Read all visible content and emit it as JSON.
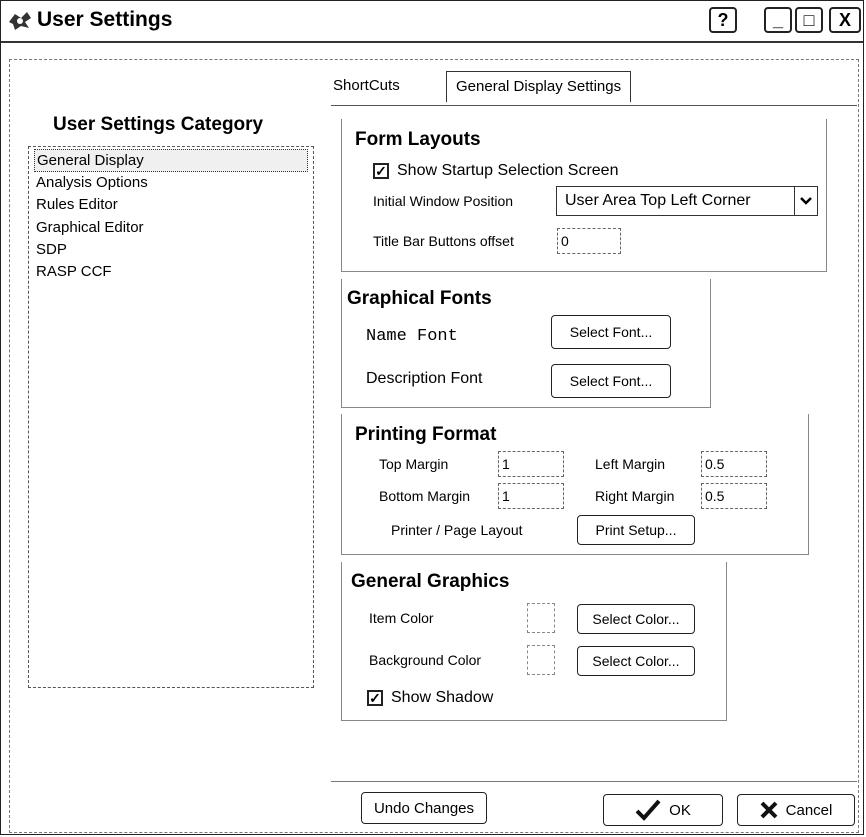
{
  "window": {
    "title": "User Settings",
    "help_glyph": "?",
    "minimize_glyph": "_",
    "maximize_glyph": "□",
    "close_glyph": "X"
  },
  "categories": {
    "title": "User Settings Category",
    "items": [
      "General Display",
      "Analysis Options",
      "Rules Editor",
      "Graphical Editor",
      "SDP",
      "RASP CCF"
    ],
    "selected": "General Display"
  },
  "tabs": [
    {
      "label": "ShortCuts",
      "active": false
    },
    {
      "label": "General Display Settings",
      "active": true
    }
  ],
  "form_layouts": {
    "title": "Form Layouts",
    "show_startup_label": "Show Startup Selection Screen",
    "show_startup_checked": true,
    "initial_window_label": "Initial Window Position",
    "initial_window_value": "User Area Top Left Corner",
    "title_bar_offset_label": "Title Bar Buttons offset",
    "title_bar_offset_value": "0"
  },
  "graphical_fonts": {
    "title": "Graphical Fonts",
    "name_font_label": "Name Font",
    "description_font_label": "Description Font",
    "select_font_label": "Select Font..."
  },
  "printing_format": {
    "title": "Printing Format",
    "top_margin_label": "Top Margin",
    "top_margin_value": "1",
    "left_margin_label": "Left Margin",
    "left_margin_value": "0.5",
    "bottom_margin_label": "Bottom Margin",
    "bottom_margin_value": "1",
    "right_margin_label": "Right Margin",
    "right_margin_value": "0.5",
    "page_layout_label": "Printer / Page Layout",
    "print_setup_label": "Print Setup..."
  },
  "general_graphics": {
    "title": "General Graphics",
    "item_color_label": "Item Color",
    "background_color_label": "Background Color",
    "select_color_label": "Select Color...",
    "show_shadow_label": "Show Shadow",
    "show_shadow_checked": true
  },
  "footer": {
    "undo_label": "Undo Changes",
    "ok_label": "OK",
    "cancel_label": "Cancel"
  },
  "colors": {
    "ok_check": "#111111",
    "cancel_x": "#111111"
  }
}
